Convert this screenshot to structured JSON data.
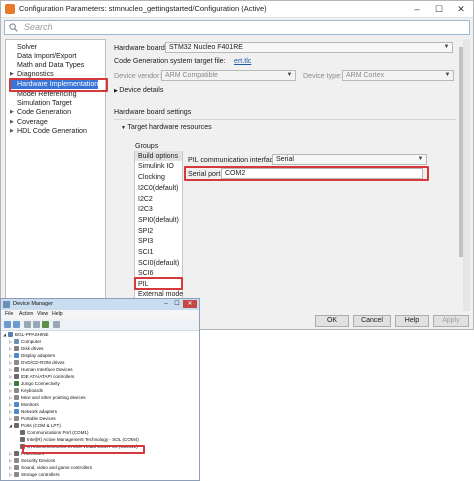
{
  "cfg": {
    "title": "Configuration Parameters: stmnucleo_gettingstarted/Configuration (Active)",
    "search_placeholder": "Search",
    "tree": [
      {
        "label": "Solver",
        "expand": ""
      },
      {
        "label": "Data Import/Export",
        "expand": ""
      },
      {
        "label": "Math and Data Types",
        "expand": ""
      },
      {
        "label": "Diagnostics",
        "expand": "▶"
      },
      {
        "label": "Hardware Implementation",
        "expand": ""
      },
      {
        "label": "Model Referencing",
        "expand": ""
      },
      {
        "label": "Simulation Target",
        "expand": ""
      },
      {
        "label": "Code Generation",
        "expand": "▶"
      },
      {
        "label": "Coverage",
        "expand": "▶"
      },
      {
        "label": "HDL Code Generation",
        "expand": "▶"
      }
    ],
    "hardware_board_label": "Hardware board:",
    "hardware_board_value": "STM32 Nucleo F401RE",
    "codegen_target_label": "Code Generation system target file:",
    "codegen_target_link": "ert.tlc",
    "device_vendor_label": "Device vendor:",
    "device_vendor_value": "ARM Compatible",
    "device_type_label": "Device type:",
    "device_type_value": "ARM Cortex",
    "device_details": "Device details",
    "board_settings": "Hardware board settings",
    "target_resources": "Target hardware resources",
    "groups_label": "Groups",
    "groups": [
      "Build options",
      "Simulink IO",
      "Clocking",
      "I2C0(default)",
      "I2C2",
      "I2C3",
      "SPI0(default)",
      "SPI2",
      "SPI3",
      "SCI1",
      "SCI0(default)",
      "SCI6",
      "PIL",
      "External mode"
    ],
    "pil_interface_label": "PIL communication interface:",
    "pil_interface_value": "Serial",
    "serial_port_label": "Serial port:",
    "serial_port_value": "COM2",
    "buttons": {
      "ok": "OK",
      "cancel": "Cancel",
      "help": "Help",
      "apply": "Apply"
    }
  },
  "dm": {
    "title": "Device Manager",
    "menu": [
      "File",
      "Action",
      "View",
      "Help"
    ],
    "tree": [
      {
        "label": "BGL-PPASHINE",
        "level": 0,
        "expand": "◢",
        "color": "#5a7fb0"
      },
      {
        "label": "Computer",
        "level": 1,
        "expand": "▷",
        "color": "#6e8db3"
      },
      {
        "label": "Disk drives",
        "level": 1,
        "expand": "▷",
        "color": "#808080"
      },
      {
        "label": "Display adapters",
        "level": 1,
        "expand": "▷",
        "color": "#4e8ac9"
      },
      {
        "label": "DVD/CD-ROM drives",
        "level": 1,
        "expand": "▷",
        "color": "#8a8a8a"
      },
      {
        "label": "Human Interface Devices",
        "level": 1,
        "expand": "▷",
        "color": "#7a7a7a"
      },
      {
        "label": "IDE ATA/ATAPI controllers",
        "level": 1,
        "expand": "▷",
        "color": "#6b6b6b"
      },
      {
        "label": "Jungo Connectivity",
        "level": 1,
        "expand": "▷",
        "color": "#3d7a3d"
      },
      {
        "label": "Keyboards",
        "level": 1,
        "expand": "▷",
        "color": "#8a8a8a"
      },
      {
        "label": "Mice and other pointing devices",
        "level": 1,
        "expand": "▷",
        "color": "#8a8a8a"
      },
      {
        "label": "Monitors",
        "level": 1,
        "expand": "▷",
        "color": "#4e8ac9"
      },
      {
        "label": "Network adapters",
        "level": 1,
        "expand": "▷",
        "color": "#4e8ac9"
      },
      {
        "label": "Portable Devices",
        "level": 1,
        "expand": "▷",
        "color": "#8a8a8a"
      },
      {
        "label": "Ports (COM & LPT)",
        "level": 1,
        "expand": "◢",
        "color": "#6b6b6b"
      },
      {
        "label": "Communications Port (COM1)",
        "level": 2,
        "expand": "",
        "color": "#6b6b6b"
      },
      {
        "label": "Intel(R) Active Management Technology - SOL (COM4)",
        "level": 2,
        "expand": "",
        "color": "#6b6b6b"
      },
      {
        "label": "STMicroelectronics STLink Virtual COM Port (COM10)",
        "level": 2,
        "expand": "",
        "color": "#6b6b6b"
      },
      {
        "label": "Processors",
        "level": 1,
        "expand": "▷",
        "color": "#6b6b6b"
      },
      {
        "label": "Security Devices",
        "level": 1,
        "expand": "▷",
        "color": "#8a8a8a"
      },
      {
        "label": "Sound, video and game controllers",
        "level": 1,
        "expand": "▷",
        "color": "#8a8a8a"
      },
      {
        "label": "Storage controllers",
        "level": 1,
        "expand": "▷",
        "color": "#8a8a8a"
      }
    ]
  },
  "colors": {
    "highlight_red": "#d6393b",
    "selection_blue": "#3875d7",
    "link_blue": "#1e5aa8"
  }
}
